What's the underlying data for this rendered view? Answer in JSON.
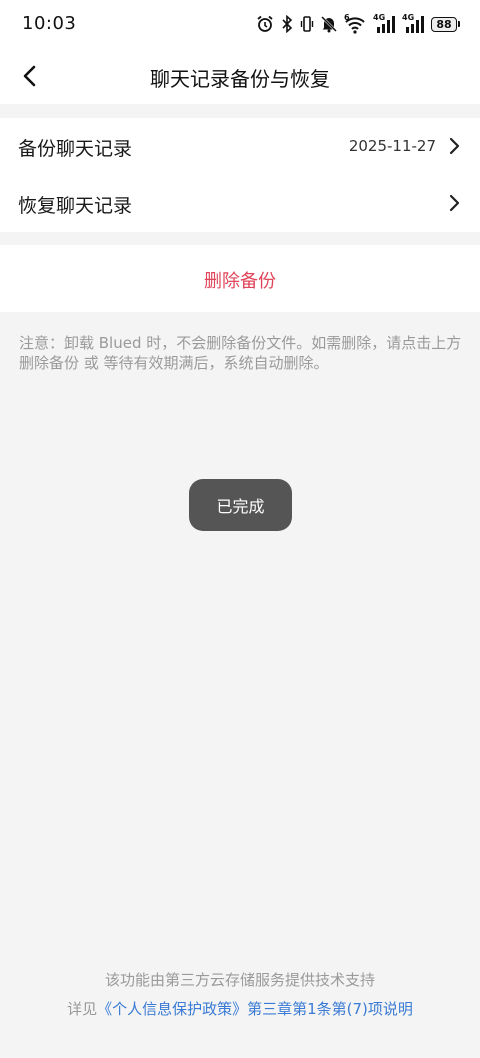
{
  "status_bar": {
    "time": "10:03",
    "network_1": "4G",
    "network_2": "4G",
    "wifi_tag": "6",
    "battery": "88",
    "icons": [
      "alarm-icon",
      "bluetooth-icon",
      "vibrate-icon",
      "mute-icon",
      "wifi-icon",
      "signal-icon",
      "signal-icon",
      "battery-icon"
    ]
  },
  "header": {
    "title": "聊天记录备份与恢复",
    "back_icon": "chevron-left-icon"
  },
  "list": {
    "backup": {
      "label": "备份聊天记录",
      "value": "2025-11-27"
    },
    "restore": {
      "label": "恢复聊天记录"
    }
  },
  "delete": {
    "label": "删除备份",
    "color": "#e0455a"
  },
  "note": "注意：卸载 Blued 时，不会删除备份文件。如需删除，请点击上方删除备份 或 等待有效期满后，系统自动删除。",
  "toast": "已完成",
  "footer": {
    "line1": "该功能由第三方云存储服务提供技术支持",
    "line2_prefix": "详见",
    "line2_link": "《个人信息保护政策》第三章第1条第(7)项说明",
    "link_color": "#3a7bd5"
  }
}
